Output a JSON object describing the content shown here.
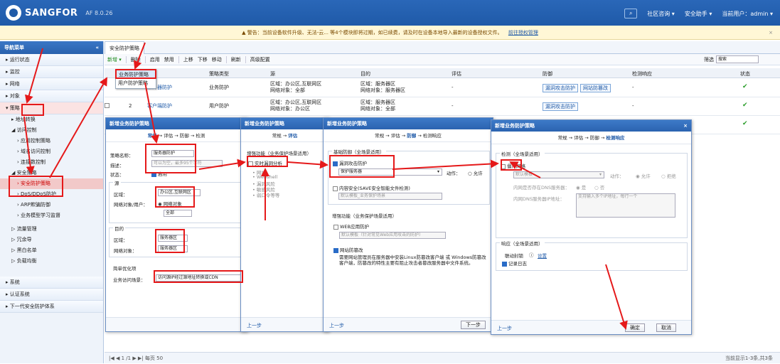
{
  "header": {
    "brand": "SANGFOR",
    "version": "AF 8.0.26",
    "menu_items": [
      "社区咨询 ▾",
      "安全助手 ▾",
      "当前用户：admin ▾"
    ]
  },
  "notice": {
    "text": "警告：当前设备软件升级、无法-云...  等4个模块即将过期，如已续费，请及时在设备本地导入最新的设备授权文件。",
    "link": "前往授权管理",
    "close": "×"
  },
  "sidebar": {
    "title": "导航菜单",
    "collapse": "«",
    "items": [
      "运行状态",
      "监控",
      "网络",
      "对象",
      "策略"
    ],
    "policy_children": [
      "地址转换",
      "访问控制",
      "应用控制策略",
      "域名访问控制",
      "连接数控制",
      "安全策略",
      "安全防护策略",
      "DoS/DDoS防护",
      "ARP欺骗防御",
      "业务模型学习监督",
      "流量管理",
      "冗余导",
      "黑白名单",
      "负载均衡"
    ],
    "bottom_items": [
      "系统",
      "认证系统",
      "下一代安全防护体系"
    ]
  },
  "main": {
    "tab": "安全防护策略",
    "toolbar": [
      "新增 ▾",
      "删除",
      "启用",
      "禁用",
      "上移",
      "下移",
      "移动",
      "刷新",
      "高级配置"
    ],
    "search_label": "筛选",
    "search_placeholder": "搜索",
    "columns": [
      "序号",
      "名称",
      "策略类型",
      "源",
      "目的",
      "评估",
      "防御",
      "检测响应",
      "状态"
    ],
    "rows": [
      {
        "no": "1",
        "name": "服务器防护",
        "type": "业务防护",
        "src": [
          "区域：办公区,互联网区",
          "网络对象：全部"
        ],
        "dst": [
          "区域：服务器区",
          "网络对象：服务器区"
        ],
        "eval": "-",
        "defense": [
          "漏洞攻击防护",
          "网站防篡改"
        ],
        "detect": "-",
        "status": "✔"
      },
      {
        "no": "2",
        "name": "客户端防护",
        "type": "用户防护",
        "src": [
          "区域：办公区,互联网区",
          "网络对象：办公区"
        ],
        "dst": [
          "区域：服务器区",
          "网络对象：全部"
        ],
        "eval": "-",
        "defense": [
          "漏洞攻击防护"
        ],
        "detect": "-",
        "status": "✔"
      },
      {
        "no": "3",
        "name": "",
        "type": "",
        "src": [],
        "dst": [],
        "eval": "-",
        "defense": [],
        "detect": "-",
        "status": "✔"
      }
    ],
    "dropdown": [
      "业务防护策略",
      "用户防护策略"
    ],
    "pager": {
      "page": "1",
      "of": "/1",
      "per_page": "每页 50",
      "summary": "当前显示1-3条,共3条"
    }
  },
  "dialog1": {
    "title": "新增业务防护策略",
    "steps": [
      "常规",
      "评估",
      "防御",
      "检测"
    ],
    "name_label": "策略名称：",
    "name_value": "服务器防护",
    "desc_label": "描述：",
    "desc_placeholder": "可以为空，最多95个字符",
    "state_label": "状态：",
    "state_value": "启用",
    "src_section": "源",
    "zone_label": "区域：",
    "zone_value": "办公区,互联网区",
    "netobj_label": "网络对象/用户：",
    "netobj_option": "网络对象",
    "netobj_value": "全部",
    "dst_section": "目的",
    "dst_zone_label": "区域：",
    "dst_zone_value": "服务器区",
    "dst_obj_label": "网络对象：",
    "dst_obj_value": "服务器区",
    "opt_section": "简单优化项",
    "scene_label": "业务访问场景：",
    "scene_value": "访问源IP经过源地址转换或CDN"
  },
  "dialog2": {
    "title": "新增业务防护策略",
    "steps": [
      "常规",
      "评估"
    ],
    "section": "增强功能（业务保护场景适用）",
    "realtime": "实时漏洞分析",
    "list": [
      "• 网站",
      "• Webshell",
      "• 漏洞风险",
      "• 敏感风险",
      "• 弱口令等等"
    ],
    "prev": "上一步"
  },
  "dialog3": {
    "title": "新增业务防护策略",
    "steps": [
      "常规",
      "评估",
      "防御",
      "检测响应"
    ],
    "basic_section": "基础防御（全场景适用）",
    "vuln": "漏洞攻击防护",
    "vuln_select": "保护服务器",
    "action_label": "动作：",
    "action_value": "允许",
    "content": "内容安全(SAVE安全智能文件检测)",
    "content_select": "默认模板_业务保护场景",
    "enhance_section": "增强功能（业务保护场景适用）",
    "waf": "WEB应用防护",
    "waf_select": "默认模板（针对常见Web应用攻击的防护）",
    "tamper": "网站防篡改",
    "tamper_desc": "需要网站管理员在服务器中安装Linux防篡改客户端 或 Windows防篡改客户端，防篡改的特性主要有阻止攻击者篡改服务器中文件系统。",
    "prev": "上一步",
    "next": "下一步"
  },
  "dialog4": {
    "title": "新增业务防护策略",
    "close": "×",
    "steps": [
      "常规",
      "评估",
      "防御",
      "检测响应"
    ],
    "detect_section": "检测（全场景适用）",
    "ids": "僵尸网络",
    "ids_select": "默认模板",
    "action_label": "动作：",
    "action_allow": "允许",
    "action_deny": "拒绝",
    "dns_label": "内网是否存在DNS服务器：",
    "dns_yes": "是",
    "dns_no": "否",
    "dns_addr_label": "内网DNS服务器IP地址：",
    "dns_addr_placeholder": "支持输入多个IP地址，每行一个",
    "resp_section": "响应（全场景适用）",
    "linkage": "联动封锁",
    "setting": "设置",
    "log": "记录日志",
    "prev": "上一步",
    "ok": "确定",
    "cancel": "取消"
  }
}
